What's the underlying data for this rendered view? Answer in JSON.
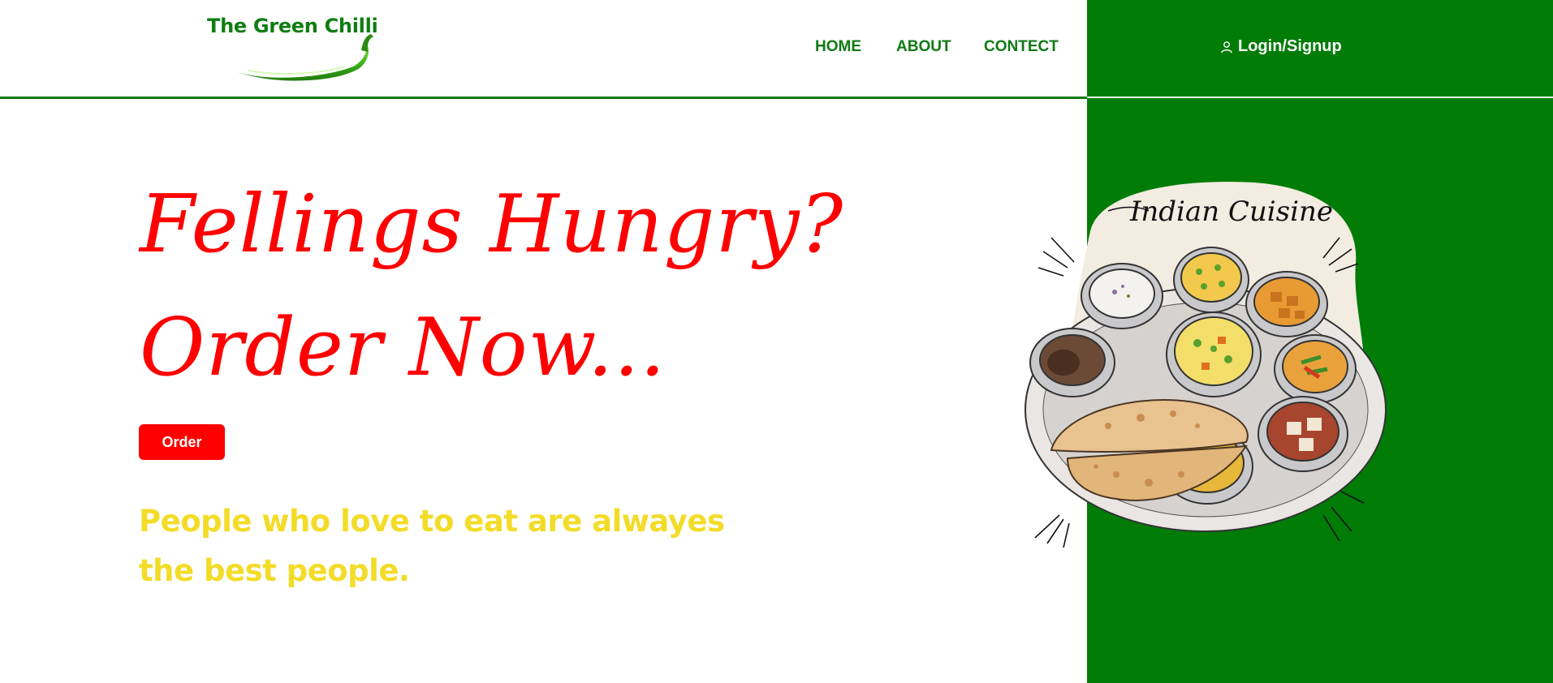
{
  "brand": {
    "name": "The Green Chilli",
    "logo_icon": "green-chilli-icon"
  },
  "nav": {
    "home": "HOME",
    "about": "ABOUT",
    "contect": "CONTECT"
  },
  "auth": {
    "login_label": "Login/Signup",
    "icon": "user-icon"
  },
  "hero": {
    "line1": "Fellings Hungry?",
    "line2": "Order Now...",
    "order_label": "Order",
    "tagline": "People who love to eat are alwayes the best people."
  },
  "image": {
    "caption": "Indian Cuisine"
  },
  "colors": {
    "brand_green": "#007c07",
    "accent_red": "#ff0000",
    "tagline_yellow": "#f3dc28",
    "text_green": "#0f7a14"
  }
}
